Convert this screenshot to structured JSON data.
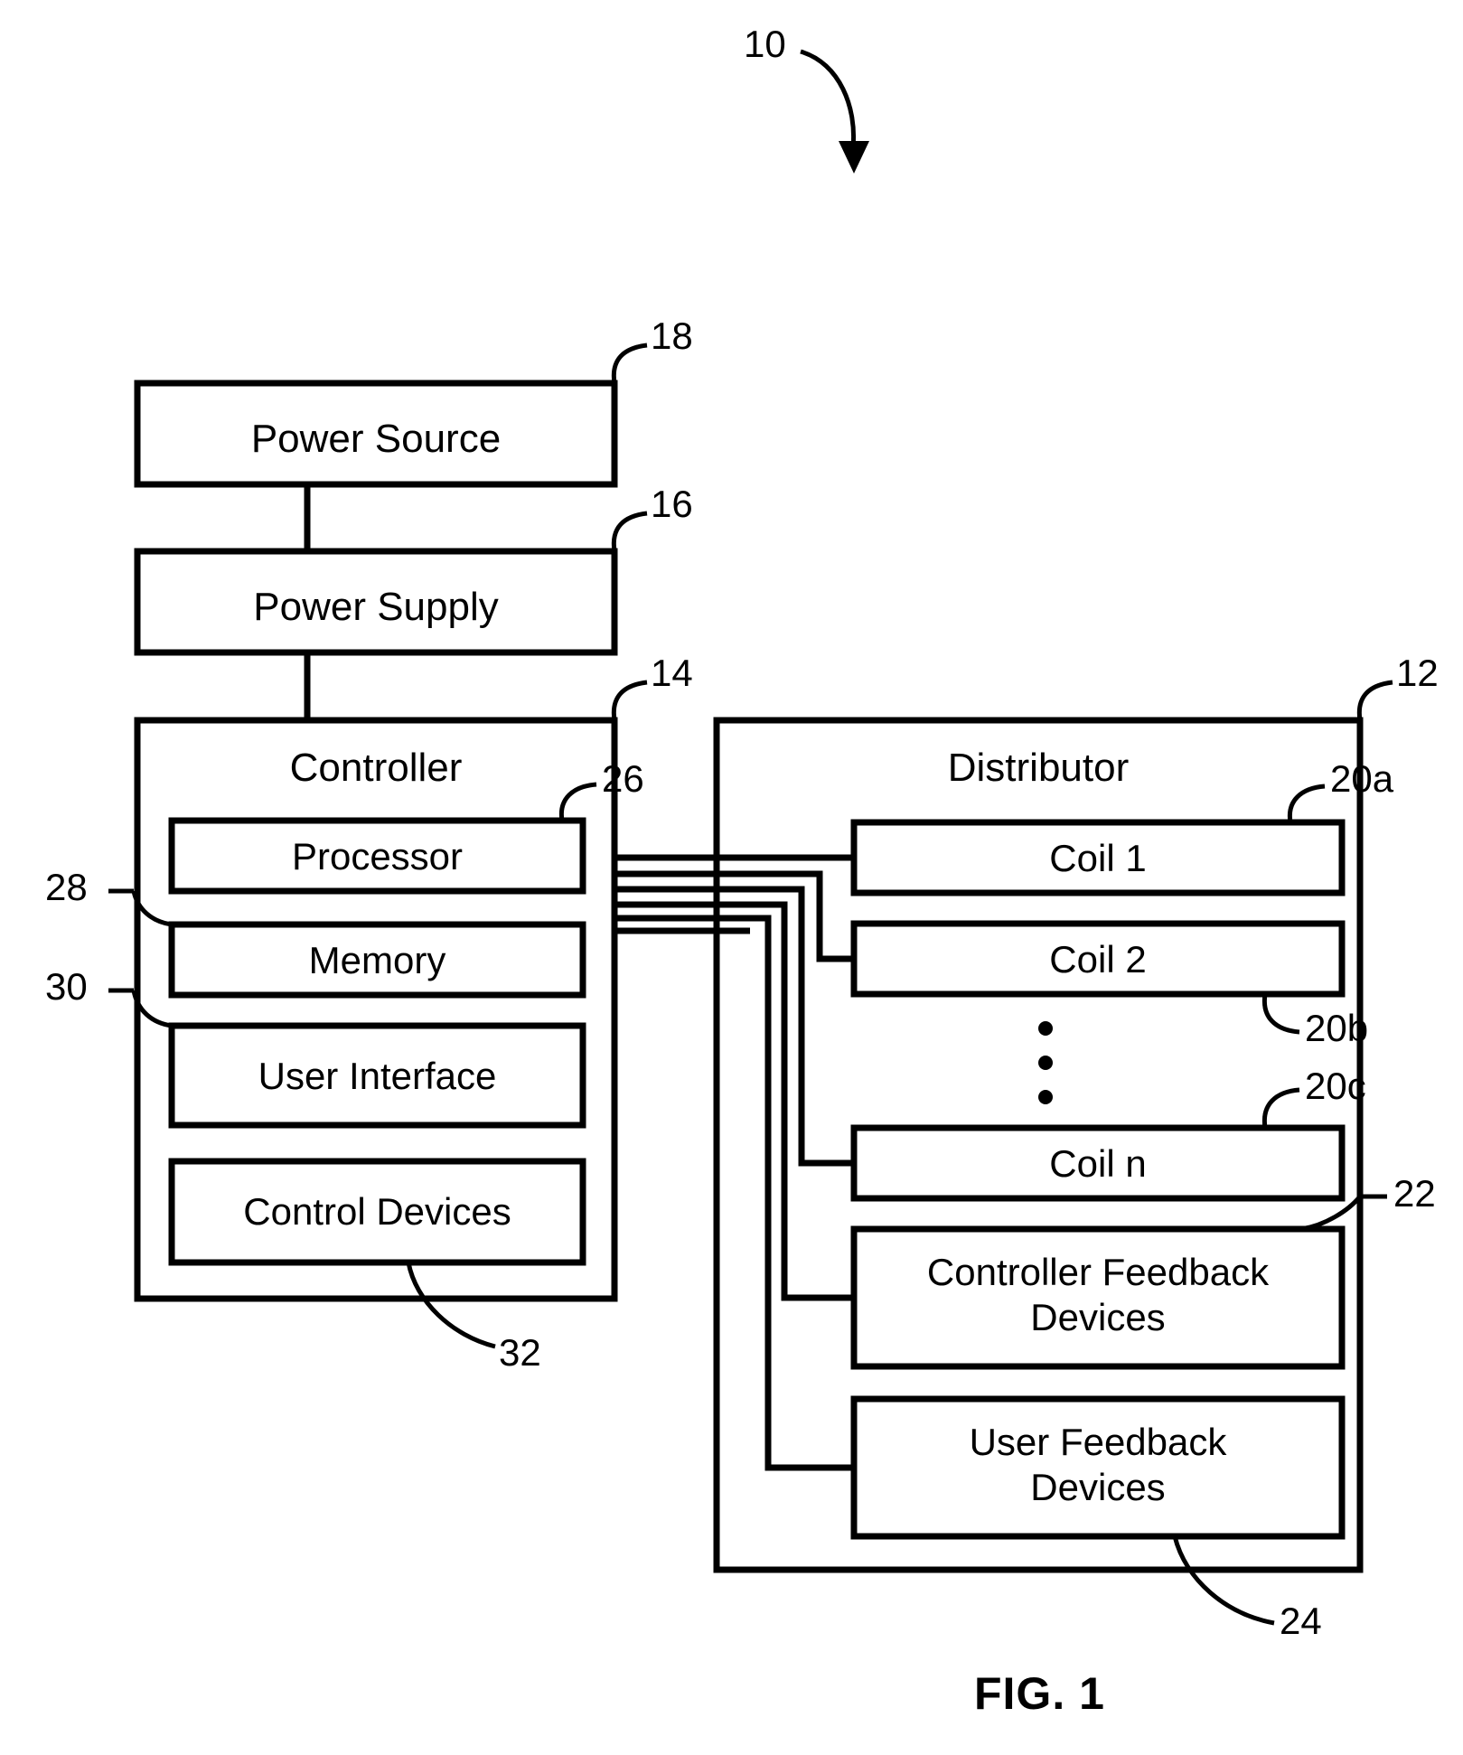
{
  "figure": {
    "caption": "FIG. 1",
    "system_ref": "10"
  },
  "blocks": {
    "power_source": {
      "label": "Power Source",
      "ref": "18"
    },
    "power_supply": {
      "label": "Power Supply",
      "ref": "16"
    },
    "controller": {
      "label": "Controller",
      "ref": "14"
    },
    "processor": {
      "label": "Processor",
      "ref": "26"
    },
    "memory": {
      "label": "Memory",
      "ref": "28"
    },
    "user_interface": {
      "label": "User Interface",
      "ref": "30"
    },
    "control_devices": {
      "label": "Control Devices",
      "ref": "32"
    },
    "distributor": {
      "label": "Distributor",
      "ref": "12"
    },
    "coil_1": {
      "label": "Coil 1",
      "ref": "20a"
    },
    "coil_2": {
      "label": "Coil 2",
      "ref": "20b"
    },
    "coil_n": {
      "label": "Coil n",
      "ref": "20c"
    },
    "controller_feedback_devices": {
      "label": "Controller Feedback\nDevices",
      "ref": "22"
    },
    "user_feedback_devices": {
      "label": "User Feedback\nDevices",
      "ref": "24"
    }
  },
  "ellipsis": {
    "symbol": "•"
  },
  "colors": {
    "ink": "#000000",
    "paper": "#ffffff"
  }
}
